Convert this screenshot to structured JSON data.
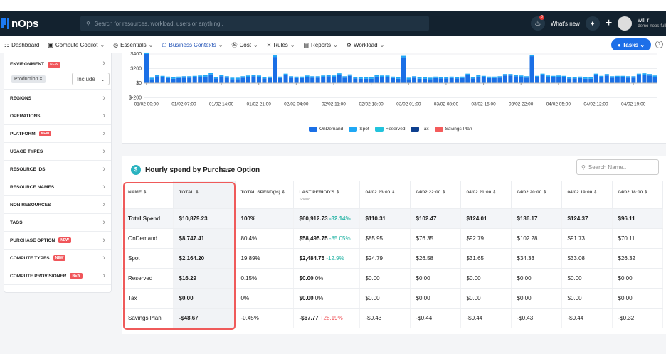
{
  "app": {
    "logo": "nOps",
    "search_placeholder": "Search for resources, workload, users or anything..",
    "whats_new": "What's new",
    "notif_count": "8",
    "user_name": "will r",
    "user_org": "demo-nops-full"
  },
  "menu": [
    {
      "label": "Dashboard",
      "icon": "grid-icon"
    },
    {
      "label": "Compute Copilot",
      "icon": "copilot-icon"
    },
    {
      "label": "Essentials",
      "icon": "essentials-icon"
    },
    {
      "label": "Business Contexts",
      "icon": "org-icon",
      "active": true
    },
    {
      "label": "Cost",
      "icon": "dollar-icon"
    },
    {
      "label": "Rules",
      "icon": "rules-icon"
    },
    {
      "label": "Reports",
      "icon": "report-icon"
    },
    {
      "label": "Workload",
      "icon": "gear-icon"
    }
  ],
  "tasks_label": "Tasks",
  "sidebar": {
    "environment": {
      "label": "ENVIRONMENT",
      "new": "NEW",
      "chip": "Production ×",
      "mode": "Include"
    },
    "items": [
      {
        "label": "REGIONS"
      },
      {
        "label": "OPERATIONS"
      },
      {
        "label": "PLATFORM",
        "new": "NEW"
      },
      {
        "label": "USAGE TYPES"
      },
      {
        "label": "RESOURCE IDS"
      },
      {
        "label": "RESOURCE NAMES"
      },
      {
        "label": "NON RESOURCES"
      },
      {
        "label": "TAGS"
      },
      {
        "label": "PURCHASE OPTION",
        "new": "NEW"
      },
      {
        "label": "COMPUTE TYPES",
        "new": "NEW"
      },
      {
        "label": "COMPUTE PROVISIONER",
        "new": "NEW"
      }
    ]
  },
  "chart_data": {
    "type": "bar",
    "stacked": true,
    "ylim": [
      -200,
      420
    ],
    "yticks": [
      "$400",
      "$200",
      "$0",
      "$-200"
    ],
    "ytick_values": [
      400,
      200,
      0,
      -200
    ],
    "xtick_labels": [
      "01/02 00:00",
      "01/02 07:00",
      "01/02 14:00",
      "01/02 21:00",
      "02/02 04:00",
      "02/02 11:00",
      "02/02 18:00",
      "03/02 01:00",
      "03/02 08:00",
      "03/02 15:00",
      "03/02 22:00",
      "04/02 05:00",
      "04/02 12:00",
      "04/02 19:00"
    ],
    "series": [
      {
        "name": "OnDemand",
        "color": "#1a6fe6",
        "values": [
          400,
          55,
          95,
          80,
          70,
          60,
          70,
          75,
          75,
          80,
          85,
          90,
          120,
          65,
          95,
          75,
          55,
          55,
          75,
          85,
          95,
          85,
          65,
          70,
          360,
          70,
          110,
          75,
          70,
          70,
          85,
          75,
          75,
          85,
          95,
          85,
          115,
          75,
          100,
          65,
          60,
          60,
          60,
          90,
          85,
          85,
          70,
          60,
          355,
          55,
          75,
          60,
          60,
          55,
          70,
          65,
          65,
          70,
          65,
          70,
          110,
          65,
          90,
          80,
          70,
          70,
          75,
          105,
          105,
          95,
          85,
          75,
          370,
          80,
          110,
          85,
          80,
          85,
          80,
          65,
          65,
          70,
          60,
          60,
          110,
          80,
          105,
          75,
          80,
          80,
          75,
          75,
          110,
          115,
          105,
          85
        ]
      },
      {
        "name": "Spot",
        "color": "#1fa8f5",
        "values": [
          20,
          20,
          20,
          20,
          20,
          20,
          20,
          20,
          20,
          20,
          20,
          20,
          20,
          20,
          20,
          20,
          20,
          20,
          20,
          20,
          20,
          20,
          20,
          20,
          20,
          20,
          20,
          20,
          20,
          20,
          20,
          20,
          20,
          20,
          20,
          20,
          20,
          20,
          20,
          20,
          20,
          20,
          20,
          20,
          20,
          20,
          20,
          20,
          20,
          20,
          20,
          20,
          20,
          20,
          20,
          20,
          20,
          20,
          20,
          20,
          20,
          20,
          20,
          20,
          20,
          20,
          20,
          20,
          20,
          20,
          20,
          20,
          20,
          20,
          20,
          20,
          20,
          20,
          20,
          20,
          20,
          20,
          20,
          20,
          20,
          20,
          20,
          20,
          20,
          20,
          20,
          20,
          20,
          20,
          20,
          20
        ]
      },
      {
        "name": "Reserved",
        "color": "#22c3dc"
      },
      {
        "name": "Tax",
        "color": "#0d3f8f"
      },
      {
        "name": "Savings Plan",
        "color": "#f45b5b"
      }
    ]
  },
  "table": {
    "title": "Hourly spend by Purchase Option",
    "search_placeholder": "Search Name..",
    "columns": [
      {
        "label": "NAME ⇕"
      },
      {
        "label": "TOTAL ⇕"
      },
      {
        "label": "TOTAL SPEND(%) ⇕"
      },
      {
        "label": "LAST PERIOD'S ⇕",
        "sub": "Spend"
      },
      {
        "label": "04/02 23:00 ⇕"
      },
      {
        "label": "04/02 22:00 ⇕"
      },
      {
        "label": "04/02 21:00 ⇕"
      },
      {
        "label": "04/02 20:00 ⇕"
      },
      {
        "label": "04/02 19:00 ⇕"
      },
      {
        "label": "04/02 18:00 ⇕"
      }
    ],
    "rows": [
      {
        "name": "Total Spend",
        "total": "$10,879.23",
        "pct": "100%",
        "last": "$60,912.73",
        "change": "-82.14%",
        "dir": "pos",
        "hours": [
          "$110.31",
          "$102.47",
          "$124.01",
          "$136.17",
          "$124.37",
          "$96.11"
        ]
      },
      {
        "name": "OnDemand",
        "total": "$8,747.41",
        "pct": "80.4%",
        "last": "$58,495.75",
        "change": "-85.05%",
        "dir": "pos",
        "hours": [
          "$85.95",
          "$76.35",
          "$92.79",
          "$102.28",
          "$91.73",
          "$70.11"
        ]
      },
      {
        "name": "Spot",
        "total": "$2,164.20",
        "pct": "19.89%",
        "last": "$2,484.75",
        "change": "-12.9%",
        "dir": "pos",
        "hours": [
          "$24.79",
          "$26.58",
          "$31.65",
          "$34.33",
          "$33.08",
          "$26.32"
        ]
      },
      {
        "name": "Reserved",
        "total": "$16.29",
        "pct": "0.15%",
        "last": "$0.00",
        "change": "0%",
        "dir": "",
        "hours": [
          "$0.00",
          "$0.00",
          "$0.00",
          "$0.00",
          "$0.00",
          "$0.00"
        ]
      },
      {
        "name": "Tax",
        "total": "$0.00",
        "pct": "0%",
        "last": "$0.00",
        "change": "0%",
        "dir": "",
        "hours": [
          "$0.00",
          "$0.00",
          "$0.00",
          "$0.00",
          "$0.00",
          "$0.00"
        ]
      },
      {
        "name": "Savings Plan",
        "total": "-$48.67",
        "pct": "-0.45%",
        "last": "-$67.77",
        "change": "+28.19%",
        "dir": "neg",
        "hours": [
          "-$0.43",
          "-$0.44",
          "-$0.44",
          "-$0.43",
          "-$0.44",
          "-$0.32"
        ]
      }
    ]
  }
}
